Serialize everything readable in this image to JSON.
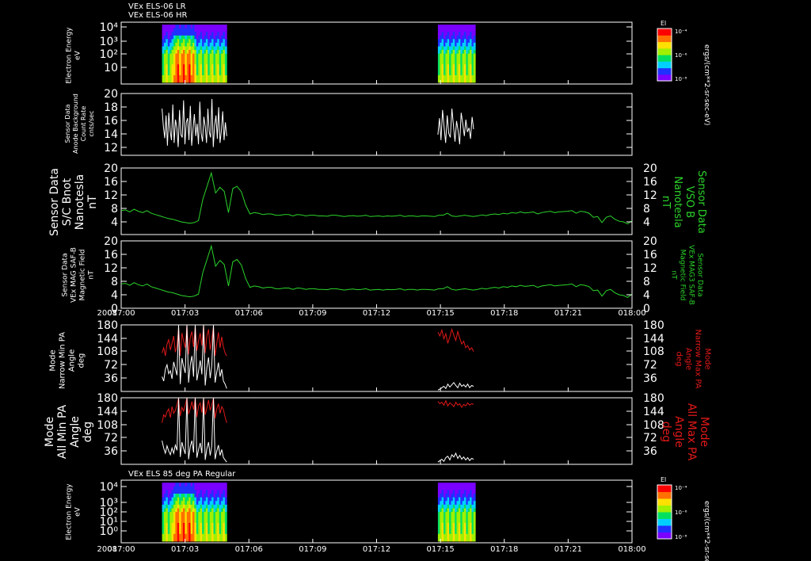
{
  "colors": {
    "background": "#000000",
    "axes": "#ffffff",
    "magnetic_field": "#2bd42b",
    "max_pitch_angle": "#e01818",
    "min_pitch_angle": "#ffffff"
  },
  "x_axis": {
    "year": "2008",
    "ticks": [
      "017:00",
      "017:03",
      "017:06",
      "017:09",
      "017:12",
      "017:15",
      "017:18",
      "017:21",
      "018:00"
    ]
  },
  "colorbar": {
    "label": "El",
    "unit_label": "ergs/(cm**2-sr-sec-eV)",
    "ticks": [
      "10⁻⁴",
      "10⁻⁶",
      "10⁻⁸"
    ],
    "colormap": [
      "#7a00ff",
      "#2030ff",
      "#00d0ff",
      "#00e060",
      "#a0f000",
      "#ffe000",
      "#ff7000",
      "#ff0000"
    ]
  },
  "chart_data": [
    {
      "type": "heatmap",
      "id": "els-energy-lr-hr",
      "title_lines": [
        "VEx ELS-06 LR",
        "VEx ELS-06 HR"
      ],
      "ylabel_lines": [
        "Electron Energy",
        "eV"
      ],
      "y_scale": "log",
      "yticks": [
        "10",
        "10²",
        "10³",
        "10⁴"
      ],
      "data_blocks": [
        {
          "t_start": "017:02.4",
          "t_end": "017:06.2"
        },
        {
          "t_start": "017:18.6",
          "t_end": "017:20.8"
        }
      ]
    },
    {
      "type": "line",
      "id": "anode-background",
      "ylabel_lines": [
        "Sensor Data",
        "Anode Background",
        "Count Rate",
        "cnts/sec"
      ],
      "ylim": [
        11,
        20
      ],
      "yticks": [
        12,
        14,
        16,
        18,
        20
      ],
      "series": [
        {
          "color": "#ffffff",
          "segments": [
            {
              "t_start": 2.4,
              "t_end": 6.2,
              "values": [
                17.8,
                15.2,
                13.5,
                16.8,
                12.4,
                17.2,
                14.6,
                13.2,
                18.4,
                12.8,
                16.2,
                15.0,
                12.2,
                17.6,
                14.0,
                13.6,
                19.0,
                12.6,
                15.8,
                16.4,
                13.2,
                18.2,
                12.4,
                14.8,
                17.0,
                13.8,
                15.6,
                12.6,
                18.8,
                14.2,
                13.0,
                16.6,
                15.2,
                12.8,
                17.8,
                14.4,
                13.6,
                19.2,
                12.2,
                15.4,
                16.8,
                13.4,
                18.0,
                12.8,
                14.6,
                17.4,
                13.2,
                15.8,
                13.8
              ]
            },
            {
              "t_start": 18.6,
              "t_end": 20.7,
              "values": [
                14.0,
                16.4,
                13.2,
                17.6,
                15.0,
                12.8,
                16.8,
                14.2,
                13.6,
                17.8,
                15.4,
                13.0,
                16.0,
                14.6,
                12.6,
                17.2,
                15.6,
                13.8,
                16.2,
                14.4,
                15.0,
                13.4,
                16.6,
                14.8
              ]
            }
          ]
        }
      ]
    },
    {
      "type": "line",
      "id": "sc-bnot",
      "ylabel_lines": [
        "Sensor Data",
        "S/C Bnot",
        "Nanotesla",
        "nT"
      ],
      "ylabel_right_lines": [
        "Sensor Data",
        "VSO B",
        "Nanotesla",
        "nT"
      ],
      "ylim": [
        0,
        20
      ],
      "yticks": [
        4,
        8,
        12,
        16,
        20
      ],
      "series": [
        {
          "color": "#2bd42b",
          "t_start": 0,
          "t_end": 30,
          "values": [
            7.2,
            7.4,
            6.8,
            7.6,
            7.0,
            6.6,
            7.2,
            6.4,
            6.0,
            5.6,
            5.2,
            4.8,
            4.6,
            4.2,
            3.8,
            3.6,
            3.4,
            3.6,
            4.2,
            10.5,
            14.5,
            18.5,
            12.5,
            14.2,
            13.0,
            6.6,
            13.8,
            14.5,
            12.8,
            8.8,
            6.2,
            6.6,
            6.4,
            6.0,
            6.2,
            6.2,
            5.8,
            5.8,
            6.0,
            6.0,
            5.6,
            6.0,
            5.9,
            5.6,
            5.8,
            5.8,
            5.6,
            5.6,
            5.5,
            5.8,
            5.8,
            5.6,
            5.4,
            5.6,
            5.7,
            5.5,
            5.6,
            5.8,
            5.4,
            5.5,
            5.6,
            5.4,
            5.6,
            5.5,
            5.6,
            5.8,
            5.4,
            5.6,
            5.6,
            5.4,
            5.6,
            5.6,
            5.5,
            5.4,
            5.8,
            5.8,
            6.4,
            5.6,
            5.4,
            5.6,
            5.8,
            5.6,
            5.4,
            5.6,
            5.9,
            5.7,
            6.0,
            6.2,
            6.0,
            6.4,
            6.2,
            6.6,
            6.4,
            6.8,
            6.5,
            6.6,
            6.8,
            6.2,
            6.6,
            6.8,
            7.0,
            6.6,
            6.8,
            6.9,
            7.0,
            7.2,
            6.4,
            7.0,
            6.8,
            6.4,
            5.2,
            5.4,
            3.6,
            5.2,
            5.6,
            4.6,
            4.0,
            3.8,
            3.2,
            4.2
          ]
        }
      ]
    },
    {
      "type": "line",
      "id": "mag-field",
      "ylabel_lines": [
        "Sensor Data",
        "VEx MAG SAF-B",
        "Magnetic Field",
        "nT"
      ],
      "ylabel_right_lines": [
        "Sensor Data",
        "VEx MAG3 SAF-B",
        "Magnetic Field",
        "nT"
      ],
      "ylim": [
        0,
        20
      ],
      "yticks": [
        0,
        4,
        8,
        12,
        16,
        20
      ],
      "series": [
        {
          "color": "#2bd42b",
          "t_start": 0,
          "t_end": 30,
          "values": [
            7.2,
            7.4,
            6.8,
            7.6,
            7.0,
            6.6,
            7.2,
            6.4,
            6.0,
            5.6,
            5.2,
            4.8,
            4.6,
            4.2,
            3.8,
            3.6,
            3.4,
            3.6,
            4.2,
            10.5,
            14.5,
            18.5,
            12.5,
            14.2,
            13.0,
            6.6,
            13.8,
            14.5,
            12.8,
            8.8,
            6.2,
            6.6,
            6.4,
            6.0,
            6.2,
            6.2,
            5.8,
            5.8,
            6.0,
            6.0,
            5.6,
            6.0,
            5.9,
            5.6,
            5.8,
            5.8,
            5.6,
            5.6,
            5.5,
            5.8,
            5.8,
            5.6,
            5.4,
            5.6,
            5.7,
            5.5,
            5.6,
            5.8,
            5.4,
            5.5,
            5.6,
            5.4,
            5.6,
            5.5,
            5.6,
            5.8,
            5.4,
            5.6,
            5.6,
            5.4,
            5.6,
            5.6,
            5.5,
            5.4,
            5.8,
            5.8,
            6.4,
            5.6,
            5.4,
            5.6,
            5.8,
            5.6,
            5.4,
            5.6,
            5.9,
            5.7,
            6.0,
            6.2,
            6.0,
            6.4,
            6.2,
            6.6,
            6.4,
            6.8,
            6.5,
            6.6,
            6.8,
            6.2,
            6.6,
            6.8,
            7.0,
            6.6,
            6.8,
            6.9,
            7.0,
            7.2,
            6.4,
            7.0,
            6.8,
            6.4,
            5.2,
            5.4,
            3.6,
            5.2,
            5.6,
            4.6,
            4.0,
            3.8,
            3.2,
            4.2
          ]
        }
      ]
    },
    {
      "type": "line",
      "id": "narrow-pa",
      "ylabel_lines": [
        "Mode",
        "Narrow Min PA",
        "Angle",
        "deg"
      ],
      "ylabel_right_lines": [
        "Mode",
        "Narrow Max PA",
        "Angle",
        "deg"
      ],
      "ylim": [
        0,
        180
      ],
      "yticks": [
        36,
        72,
        108,
        144,
        180
      ],
      "series": [
        {
          "color": "#e01818",
          "segments": [
            {
              "t_start": 2.4,
              "t_end": 6.2,
              "values": [
                104,
                118,
                96,
                128,
                140,
                112,
                130,
                150,
                106,
                124,
                172,
                96,
                158,
                136,
                118,
                180,
                100,
                146,
                162,
                120,
                176,
                110,
                138,
                158,
                124,
                180,
                104,
                150,
                168,
                112,
                142,
                176,
                96,
                130,
                160,
                118,
                148,
                120,
                104,
                96
              ]
            },
            {
              "t_start": 18.6,
              "t_end": 20.7,
              "values": [
                160,
                150,
                166,
                142,
                156,
                130,
                148,
                168,
                152,
                138,
                162,
                144,
                128,
                136,
                118,
                124,
                112,
                118,
                108
              ]
            }
          ]
        },
        {
          "color": "#ffffff",
          "segments": [
            {
              "t_start": 2.4,
              "t_end": 6.2,
              "values": [
                40,
                28,
                60,
                72,
                48,
                56,
                34,
                80,
                62,
                44,
                180,
                20,
                90,
                68,
                50,
                180,
                24,
                72,
                96,
                40,
                180,
                30,
                56,
                84,
                46,
                180,
                16,
                64,
                92,
                36,
                70,
                180,
                24,
                52,
                78,
                40,
                60,
                28,
                20,
                8
              ]
            },
            {
              "t_start": 18.6,
              "t_end": 20.7,
              "values": [
                4,
                6,
                10,
                14,
                8,
                20,
                12,
                18,
                24,
                16,
                10,
                22,
                14,
                18,
                12,
                20,
                10,
                16,
                14
              ]
            }
          ]
        }
      ]
    },
    {
      "type": "line",
      "id": "all-pa",
      "ylabel_lines": [
        "Mode",
        "All Min PA",
        "Angle",
        "deg"
      ],
      "ylabel_right_lines": [
        "Mode",
        "All Max PA",
        "Angle",
        "deg"
      ],
      "ylim": [
        0,
        180
      ],
      "yticks": [
        36,
        72,
        108,
        144,
        180
      ],
      "series": [
        {
          "color": "#e01818",
          "segments": [
            {
              "t_start": 2.4,
              "t_end": 6.2,
              "values": [
                112,
                134,
                128,
                142,
                150,
                126,
                156,
                138,
                146,
                162,
                180,
                130,
                154,
                144,
                160,
                180,
                136,
                150,
                170,
                148,
                180,
                128,
                158,
                166,
                140,
                180,
                134,
                152,
                174,
                146,
                160,
                180,
                124,
                150,
                164,
                138,
                156,
                148,
                128,
                112
              ]
            },
            {
              "t_start": 18.6,
              "t_end": 20.7,
              "values": [
                170,
                164,
                168,
                160,
                172,
                158,
                166,
                162,
                156,
                168,
                160,
                164,
                154,
                162,
                158,
                166,
                160,
                164,
                162
              ]
            }
          ]
        },
        {
          "color": "#ffffff",
          "segments": [
            {
              "t_start": 2.4,
              "t_end": 6.2,
              "values": [
                64,
                44,
                30,
                50,
                36,
                26,
                44,
                30,
                52,
                38,
                180,
                20,
                60,
                42,
                28,
                180,
                14,
                48,
                64,
                32,
                180,
                18,
                40,
                58,
                30,
                180,
                12,
                42,
                60,
                24,
                50,
                180,
                14,
                36,
                52,
                24,
                40,
                18,
                12,
                6
              ]
            },
            {
              "t_start": 18.6,
              "t_end": 20.7,
              "values": [
                6,
                10,
                14,
                8,
                18,
                22,
                12,
                26,
                20,
                30,
                16,
                24,
                14,
                20,
                12,
                18,
                10,
                16,
                14
              ]
            }
          ]
        }
      ]
    },
    {
      "type": "heatmap",
      "id": "els-85deg",
      "title": "VEx ELS 85 deg PA Regular",
      "ylabel_lines": [
        "Electron Energy",
        "eV"
      ],
      "y_scale": "log",
      "yticks": [
        "10⁰",
        "10¹",
        "10²",
        "10³",
        "10⁴"
      ],
      "data_blocks": [
        {
          "t_start": "017:02.4",
          "t_end": "017:06.2"
        },
        {
          "t_start": "017:18.6",
          "t_end": "017:20.8"
        }
      ]
    }
  ]
}
